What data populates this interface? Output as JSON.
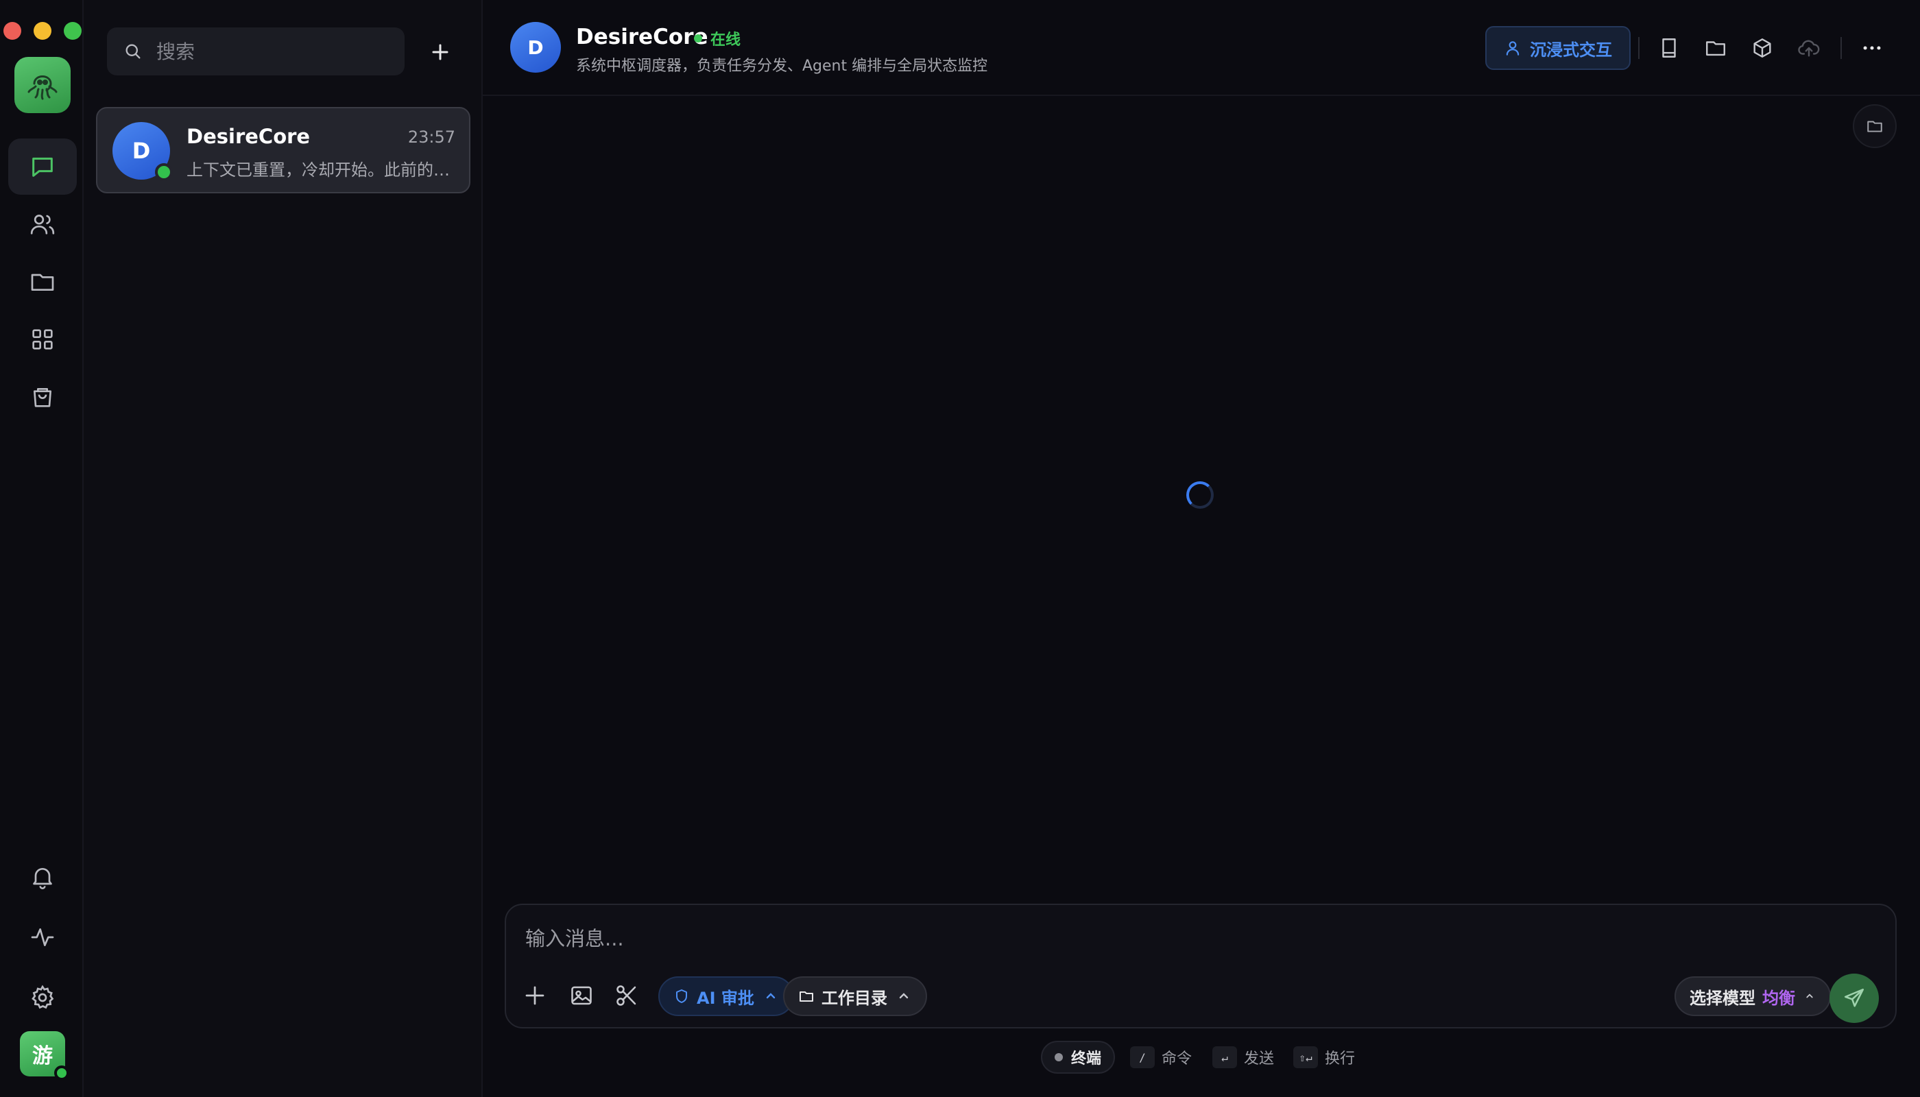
{
  "rail": {
    "logo_icon": "octopus-icon",
    "nav": [
      {
        "icon": "chat-icon",
        "active": true
      },
      {
        "icon": "users-icon",
        "active": false
      },
      {
        "icon": "folder-icon",
        "active": false
      },
      {
        "icon": "grid-icon",
        "active": false
      },
      {
        "icon": "shopping-bag-icon",
        "active": false
      }
    ],
    "bottom": [
      {
        "icon": "bell-icon"
      },
      {
        "icon": "activity-icon"
      },
      {
        "icon": "gear-icon"
      }
    ],
    "user_avatar": "游"
  },
  "list": {
    "search_placeholder": "搜索",
    "conversations": [
      {
        "avatar": "D",
        "name": "DesireCore",
        "time": "23:57",
        "preview": "上下文已重置，冷却开始。此前的对话"
      }
    ]
  },
  "header": {
    "avatar": "D",
    "title": "DesireCore",
    "status": "在线",
    "description": "系统中枢调度器，负责任务分发、Agent 编排与全局状态监控",
    "immersive_label": "沉浸式交互",
    "icons": [
      "book-icon",
      "folder-icon",
      "cube-icon",
      "cloud-upload-icon",
      "more-icon"
    ]
  },
  "composer": {
    "placeholder": "输入消息...",
    "ai_review_label": "AI 审批",
    "workdir_label": "工作目录",
    "model_label": "选择模型",
    "model_value": "均衡"
  },
  "hints": {
    "terminal": "终端",
    "command_key": "/",
    "command": "命令",
    "send_key": "↵",
    "send": "发送",
    "newline_key": "⇧↵",
    "newline": "换行"
  },
  "colors": {
    "accent_blue": "#3b7cf0",
    "online_green": "#3ec95a",
    "model_purple": "#b066f0",
    "logo_green": "#4cb862"
  }
}
